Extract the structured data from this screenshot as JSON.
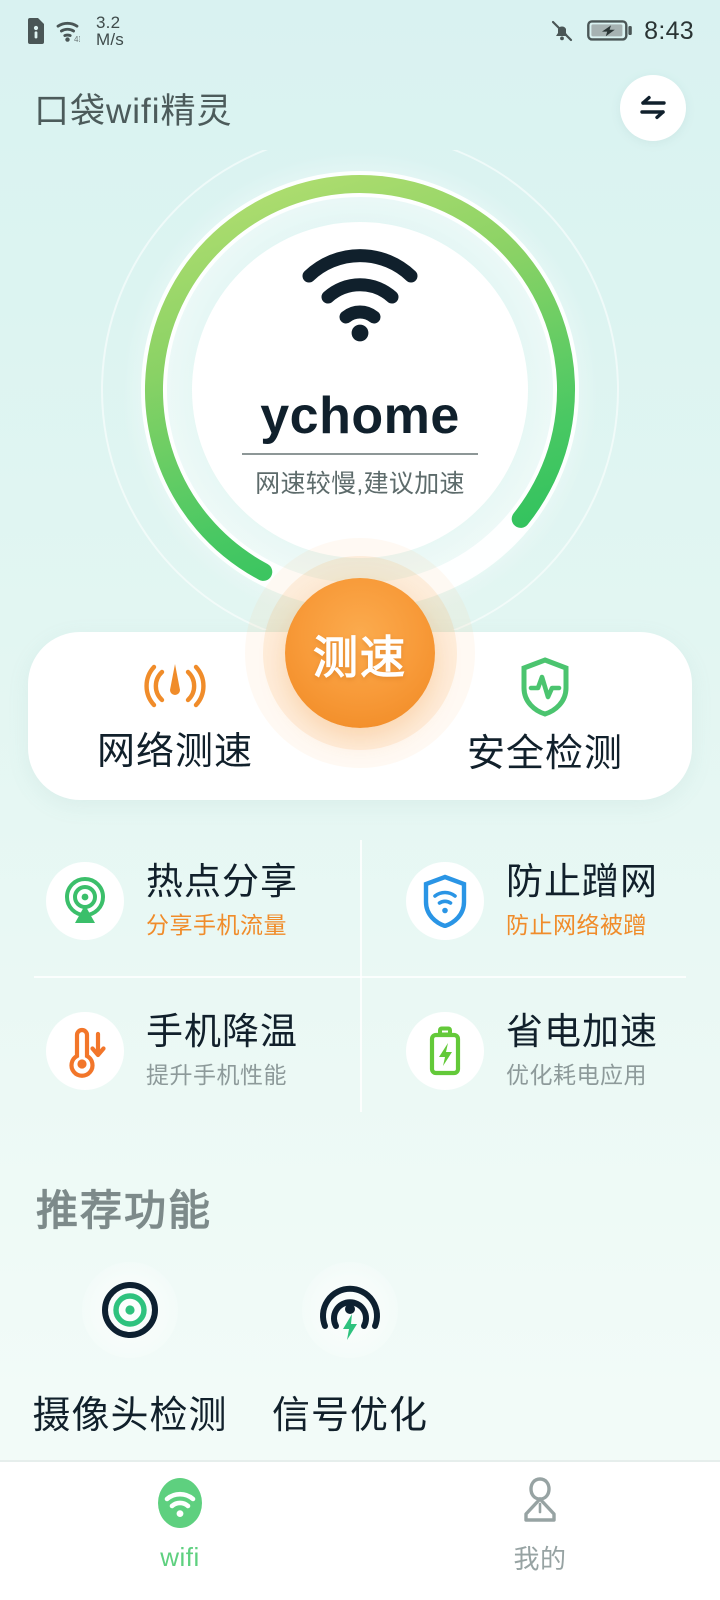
{
  "status_bar": {
    "network_speed_value": "3.2",
    "network_speed_unit": "M/s",
    "time": "8:43",
    "icons": [
      "sim-card-alert-icon",
      "wifi-4g-icon",
      "bell-muted-icon",
      "battery-charging-icon"
    ]
  },
  "header": {
    "title": "口袋wifi精灵",
    "swap_icon": "swap-horizontal-icon"
  },
  "gauge": {
    "ssid": "ychome",
    "status_text": "网速较慢,建议加速",
    "wifi_icon": "wifi-signal-icon",
    "ring_start_color": "#b2dd6e",
    "ring_end_color": "#27c05c",
    "ring_track_color": "#ffffff",
    "progress_percent": 78
  },
  "speed_button": {
    "label": "测速",
    "color": "#f59331"
  },
  "main_card": {
    "items": [
      {
        "label": "网络测速",
        "icon": "speedometer-signal-icon",
        "color": "#f08c2a"
      },
      {
        "label": "安全检测",
        "icon": "shield-pulse-icon",
        "color": "#4bc46f"
      }
    ]
  },
  "feature_grid": {
    "items": [
      {
        "title": "热点分享",
        "subtitle": "分享手机流量",
        "subtitle_style": "accent",
        "icon": "hotspot-broadcast-icon",
        "color": "#3bbf6a"
      },
      {
        "title": "防止蹭网",
        "subtitle": "防止网络被蹭",
        "subtitle_style": "accent",
        "icon": "shield-wifi-icon",
        "color": "#2a95e5"
      },
      {
        "title": "手机降温",
        "subtitle": "提升手机性能",
        "subtitle_style": "muted",
        "icon": "thermometer-down-icon",
        "color": "#f2762a"
      },
      {
        "title": "省电加速",
        "subtitle": "优化耗电应用",
        "subtitle_style": "muted",
        "icon": "battery-bolt-icon",
        "color": "#63c939"
      }
    ]
  },
  "recommended": {
    "title": "推荐功能",
    "items": [
      {
        "label": "摄像头检测",
        "icon": "camera-detect-target-icon"
      },
      {
        "label": "信号优化",
        "icon": "signal-boost-icon"
      }
    ]
  },
  "tabbar": {
    "tabs": [
      {
        "label": "wifi",
        "icon": "wifi-tab-icon",
        "active": true
      },
      {
        "label": "我的",
        "icon": "user-tab-icon",
        "active": false
      }
    ]
  }
}
